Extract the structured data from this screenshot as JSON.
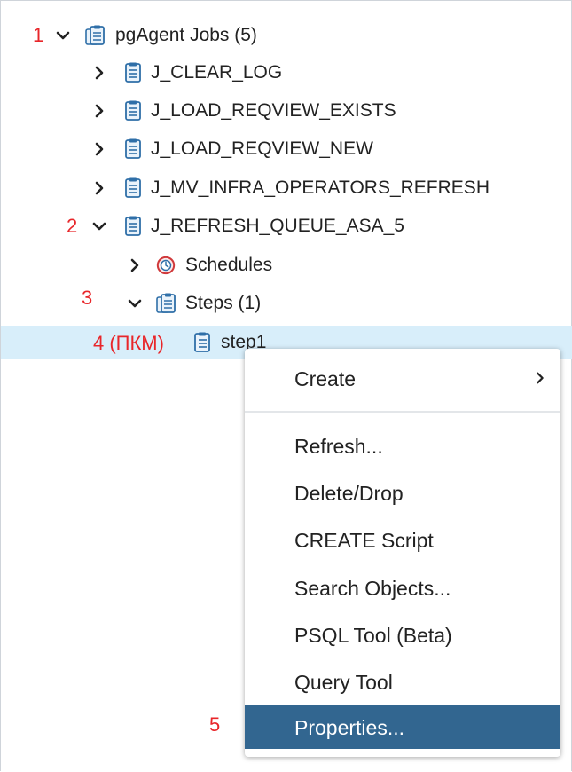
{
  "annotations": [
    "1",
    "2",
    "3",
    "4 (ПКМ)",
    "5"
  ],
  "tree": {
    "root": {
      "label": "pgAgent Jobs (5)",
      "icon": "jobs-collection-icon",
      "expanded": true
    },
    "jobs": [
      {
        "label": "J_CLEAR_LOG",
        "icon": "job-icon",
        "expanded": false
      },
      {
        "label": "J_LOAD_REQVIEW_EXISTS",
        "icon": "job-icon",
        "expanded": false
      },
      {
        "label": "J_LOAD_REQVIEW_NEW",
        "icon": "job-icon",
        "expanded": false
      },
      {
        "label": "J_MV_INFRA_OPERATORS_REFRESH",
        "icon": "job-icon",
        "expanded": false
      },
      {
        "label": "J_REFRESH_QUEUE_ASA_5",
        "icon": "job-icon",
        "expanded": true
      }
    ],
    "schedules": {
      "label": "Schedules",
      "icon": "schedule-clock-icon",
      "expanded": false
    },
    "steps": {
      "label": "Steps (1)",
      "icon": "steps-collection-icon",
      "expanded": true
    },
    "step1": {
      "label": "step1",
      "icon": "step-icon",
      "selected": true
    }
  },
  "context_menu": {
    "items": [
      {
        "label": "Create",
        "submenu": true
      },
      {
        "label": "Refresh..."
      },
      {
        "label": "Delete/Drop"
      },
      {
        "label": "CREATE Script"
      },
      {
        "label": "Search Objects..."
      },
      {
        "label": "PSQL Tool (Beta)"
      },
      {
        "label": "Query Tool"
      },
      {
        "label": "Properties...",
        "highlighted": true
      }
    ]
  },
  "colors": {
    "selection_bg": "#d8eefa",
    "menu_active_bg": "#326690",
    "annotation_red": "#e8262a",
    "icon_blue": "#2f6fa8",
    "schedule_red": "#d0393b"
  }
}
